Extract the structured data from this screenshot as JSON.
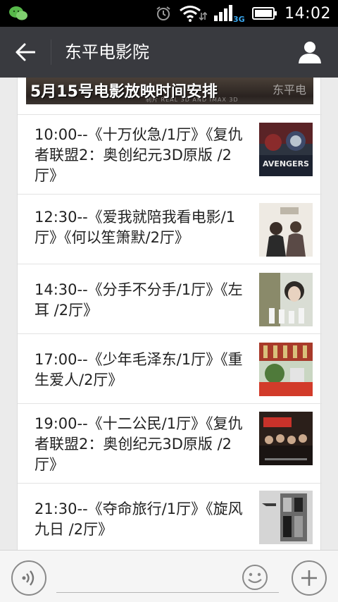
{
  "status_bar": {
    "time": "14:02",
    "network": "3G"
  },
  "header": {
    "title": "东平电影院"
  },
  "banner": {
    "text": "5月15号电影放映时间安排",
    "logo_text": "东平电",
    "strip_text": "制片  REAL 3D AND IMAX 3D"
  },
  "schedule": [
    {
      "text": "10:00--《十万伙急/1厅》《复仇者联盟2：奥创纪元3D原版 /2厅》",
      "poster_caption": "AVENGERS",
      "poster_icon": "avengers-poster-icon"
    },
    {
      "text": "12:30--《爱我就陪我看电影/1厅》《何以笙箫默/2厅》",
      "poster_caption": "",
      "poster_icon": "romance-poster-icon"
    },
    {
      "text": "14:30--《分手不分手/1厅》《左耳 /2厅》",
      "poster_caption": "",
      "poster_icon": "zuoer-poster-icon"
    },
    {
      "text": "17:00--《少年毛泽东/1厅》《重生爱人/2厅》",
      "poster_caption": "",
      "poster_icon": "reborn-poster-icon"
    },
    {
      "text": "19:00--《十二公民/1厅》《复仇者联盟2：奥创纪元3D原版 /2厅》",
      "poster_caption": "",
      "poster_icon": "citizens-poster-icon"
    },
    {
      "text": "21:30--《夺命旅行/1厅》《旋风九日 /2厅》",
      "poster_caption": "",
      "poster_icon": "travel-poster-icon"
    }
  ],
  "input_bar": {
    "placeholder": ""
  },
  "colors": {
    "titlebar": "#393a3f",
    "statusbar": "#000000",
    "background": "#ebebeb"
  }
}
